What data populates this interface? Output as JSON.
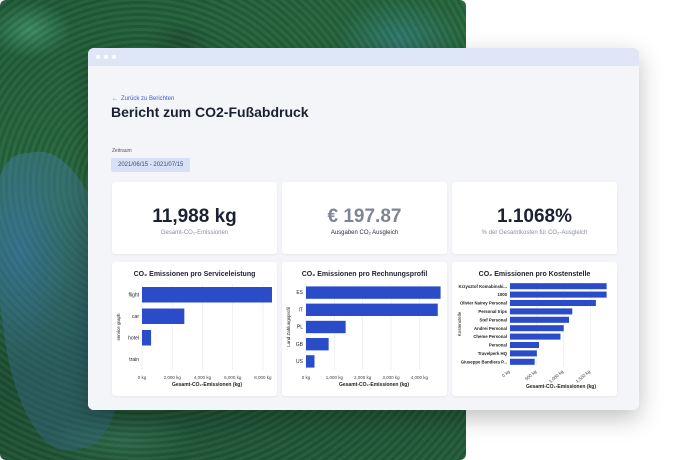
{
  "window": {
    "back_link": "Zurück zu Berichten",
    "title": "Bericht zum CO2-Fußabdruck"
  },
  "filter": {
    "label": "Zeitraum",
    "date_range": "2021/06/15 - 2021/07/15"
  },
  "kpis": [
    {
      "value": "11,988 kg",
      "label": "Gesamt-CO₂-Emissionen"
    },
    {
      "value": "€ 197.87",
      "label": "Ausgaben CO₂ Ausgleich"
    },
    {
      "value": "1.1068%",
      "label": "% der Gesamtkosten für CO₂-Ausgleich"
    }
  ],
  "colors": {
    "bar": "#2a4cc9",
    "accent": "#3b5bd6",
    "chip_bg": "#d7e0f6"
  },
  "chart_data": [
    {
      "type": "bar",
      "orientation": "horizontal",
      "title": "CO₂ Emissionen pro Serviceleistung",
      "categories": [
        "flight",
        "car",
        "hotel",
        "train"
      ],
      "values": [
        8600,
        2800,
        600,
        0
      ],
      "xlabel": "Gesamt-CO₂-Emissionen (kg)",
      "ylabel": "service graph",
      "xticks": [
        "0 kg",
        "2,000 kg",
        "4,000 kg",
        "6,000 kg",
        "8,000 kg"
      ],
      "xlim": [
        0,
        8600
      ],
      "grid": true
    },
    {
      "type": "bar",
      "orientation": "horizontal",
      "title": "CO₂ Emissionen pro Rechnungsprofil",
      "categories": [
        "ES",
        "IT",
        "PL",
        "GB",
        "US"
      ],
      "values": [
        4750,
        4650,
        1400,
        800,
        300
      ],
      "xlabel": "Gesamt-CO₂-Emissionen (kg)",
      "ylabel": "Land Zahlungsprofil",
      "xticks": [
        "0 kg",
        "1,000 kg",
        "2,000 kg",
        "3,000 kg",
        "4,000 kg"
      ],
      "xlim": [
        0,
        4800
      ],
      "grid": true
    },
    {
      "type": "bar",
      "orientation": "horizontal",
      "title": "CO₂ Emissionen pro Kostenstelle",
      "categories": [
        "Krzysztof Komabinski...",
        "1000",
        "Olivier Nairey Personal",
        "Personal trips",
        "Stef Personal",
        "Andrei Personal",
        "Cheme Personal",
        "Personal",
        "Travelperk HQ",
        "Giuseppe Bandiera P..."
      ],
      "values": [
        1800,
        1800,
        1600,
        1160,
        1100,
        1000,
        940,
        540,
        500,
        460
      ],
      "xlabel": "Gesamt-CO₂-Emissionen (kg)",
      "ylabel": "Kostenstelle",
      "xticks": [
        "0 kg",
        "500 kg",
        "1,000 kg",
        "1,500 kg",
        "2,000 kg"
      ],
      "xlim": [
        0,
        1900
      ],
      "grid": true
    }
  ]
}
